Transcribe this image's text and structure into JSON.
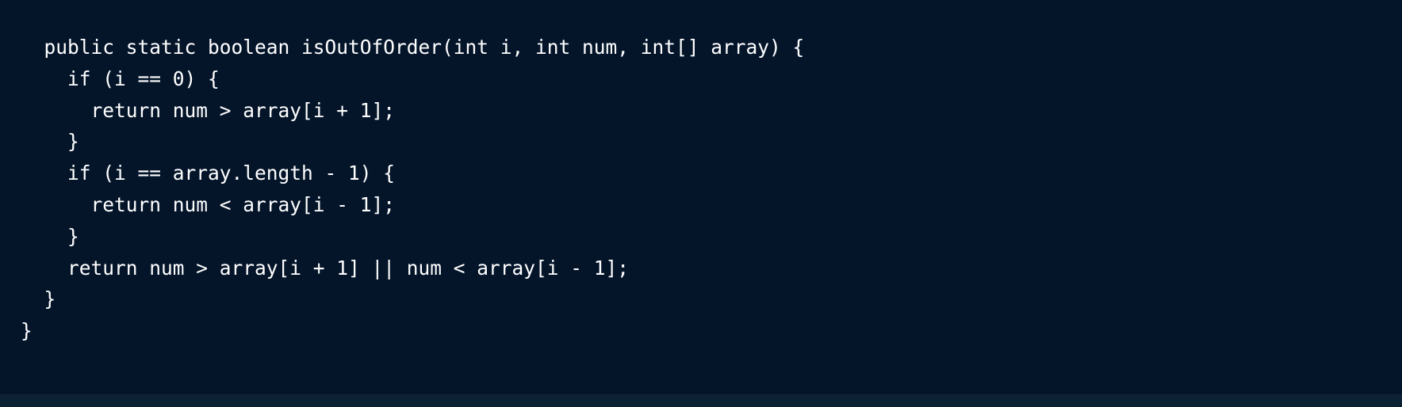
{
  "code": {
    "language": "java",
    "lines": [
      "  public static boolean isOutOfOrder(int i, int num, int[] array) {",
      "    if (i == 0) {",
      "      return num > array[i + 1];",
      "    }",
      "    if (i == array.length - 1) {",
      "      return num < array[i - 1];",
      "    }",
      "    return num > array[i + 1] || num < array[i - 1];",
      "  }",
      "}"
    ]
  },
  "colors": {
    "background": "#04152a",
    "text": "#ffffff",
    "bottom_strip": "#0d2135"
  }
}
